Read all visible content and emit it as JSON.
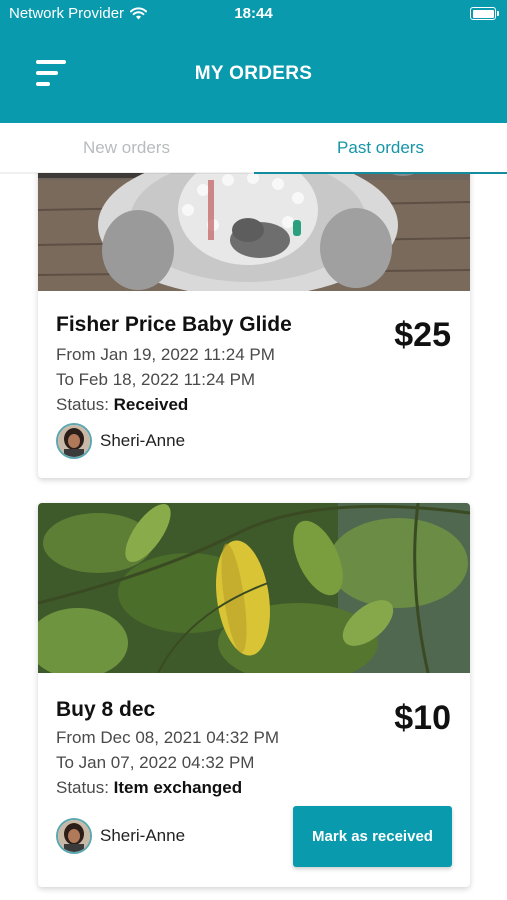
{
  "status_bar": {
    "carrier": "Network Provider",
    "time": "18:44"
  },
  "header": {
    "title": "MY ORDERS"
  },
  "tabs": [
    {
      "label": "New orders",
      "active": false
    },
    {
      "label": "Past orders",
      "active": true
    }
  ],
  "orders": [
    {
      "name": "Fisher Price Baby Glide",
      "price": "$25",
      "from": "From Jan 19, 2022 11:24 PM",
      "to": "To Feb 18, 2022 11:24 PM",
      "status_label": "Status:",
      "status": "Received",
      "seller": "Sheri-Anne"
    },
    {
      "name": "Buy 8 dec",
      "price": "$10",
      "from": "From Dec 08, 2021 04:32 PM",
      "to": "To Jan 07, 2022 04:32 PM",
      "status_label": "Status:",
      "status": "Item exchanged",
      "seller": "Sheri-Anne",
      "action_label": "Mark as received"
    }
  ],
  "colors": {
    "brand": "#0a9aad",
    "tab_active": "#1595a8",
    "tab_inactive": "#b7bcbd"
  },
  "icons": {
    "menu": "menu-icon",
    "wifi": "wifi-icon",
    "battery": "battery-icon"
  }
}
